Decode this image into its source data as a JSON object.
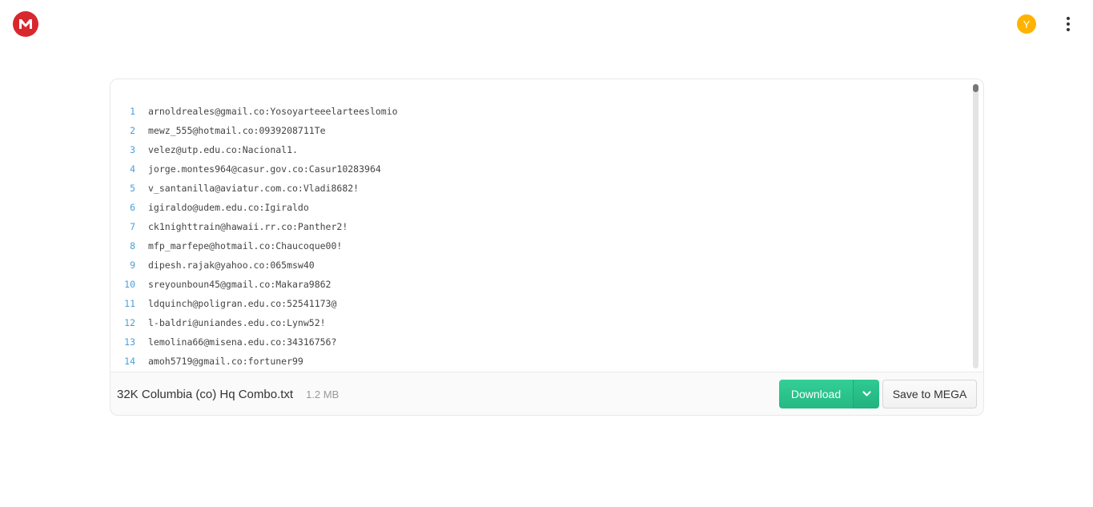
{
  "header": {
    "logo_letter": "M",
    "avatar_letter": "Y",
    "menu_icon": "kebab-menu-icon"
  },
  "file": {
    "name": "32K Columbia (co) Hq Combo.txt",
    "size": "1.2 MB",
    "lines": [
      {
        "number": "1",
        "text": "arnoldreales@gmail.co:Yosoyarteeelarteeslomio"
      },
      {
        "number": "2",
        "text": "mewz_555@hotmail.co:0939208711Te"
      },
      {
        "number": "3",
        "text": "velez@utp.edu.co:Nacional1."
      },
      {
        "number": "4",
        "text": "jorge.montes964@casur.gov.co:Casur10283964"
      },
      {
        "number": "5",
        "text": "v_santanilla@aviatur.com.co:Vladi8682!"
      },
      {
        "number": "6",
        "text": "igiraldo@udem.edu.co:Igiraldo"
      },
      {
        "number": "7",
        "text": "ck1nighttrain@hawaii.rr.co:Panther2!"
      },
      {
        "number": "8",
        "text": "mfp_marfepe@hotmail.co:Chaucoque00!"
      },
      {
        "number": "9",
        "text": "dipesh.rajak@yahoo.co:065msw40"
      },
      {
        "number": "10",
        "text": "sreyounboun45@gmail.co:Makara9862"
      },
      {
        "number": "11",
        "text": "ldquinch@poligran.edu.co:52541173@"
      },
      {
        "number": "12",
        "text": "l-baldri@uniandes.edu.co:Lynw52!"
      },
      {
        "number": "13",
        "text": "lemolina66@misena.edu.co:34316756?"
      },
      {
        "number": "14",
        "text": "amoh5719@gmail.co:fortuner99"
      }
    ]
  },
  "actions": {
    "download_label": "Download",
    "save_label": "Save to MEGA"
  },
  "colors": {
    "brand_red": "#d9272e",
    "avatar_yellow": "#ffb300",
    "download_green": "#2bc58f",
    "line_number_blue": "#4a9fd8"
  }
}
